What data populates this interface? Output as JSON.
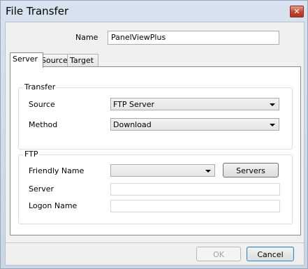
{
  "window": {
    "title": "File Transfer",
    "close_glyph": "✕"
  },
  "name_field": {
    "label": "Name",
    "value": "PanelViewPlus"
  },
  "tabs": [
    {
      "label": "Server",
      "active": true
    },
    {
      "label": "Source",
      "active": false
    },
    {
      "label": "Target",
      "active": false
    }
  ],
  "transfer": {
    "title": "Transfer",
    "source_label": "Source",
    "source_value": "FTP Server",
    "method_label": "Method",
    "method_value": "Download"
  },
  "ftp": {
    "title": "FTP",
    "friendly_name_label": "Friendly Name",
    "friendly_name_value": "",
    "servers_button": "Servers",
    "server_label": "Server",
    "server_value": "",
    "logon_label": "Logon Name",
    "logon_value": ""
  },
  "footer": {
    "ok_label": "OK",
    "cancel_label": "Cancel"
  }
}
